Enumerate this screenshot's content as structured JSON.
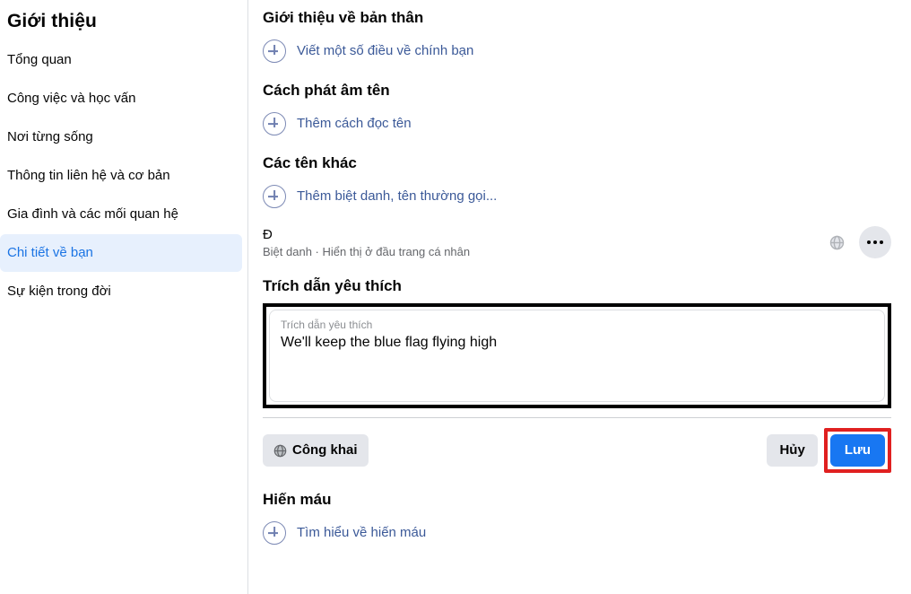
{
  "sidebar": {
    "title": "Giới thiệu",
    "items": [
      {
        "label": "Tổng quan",
        "active": false
      },
      {
        "label": "Công việc và học vấn",
        "active": false
      },
      {
        "label": "Nơi từng sống",
        "active": false
      },
      {
        "label": "Thông tin liên hệ và cơ bản",
        "active": false
      },
      {
        "label": "Gia đình và các mối quan hệ",
        "active": false
      },
      {
        "label": "Chi tiết về bạn",
        "active": true
      },
      {
        "label": "Sự kiện trong đời",
        "active": false
      }
    ]
  },
  "main": {
    "sections": {
      "bio": {
        "heading": "Giới thiệu về bản thân",
        "add_label": "Viết một số điều về chính bạn"
      },
      "pronunciation": {
        "heading": "Cách phát âm tên",
        "add_label": "Thêm cách đọc tên"
      },
      "other_names": {
        "heading": "Các tên khác",
        "add_label": "Thêm biệt danh, tên thường gọi...",
        "entry": {
          "name": "Đ",
          "meta": "Biệt danh · Hiển thị ở đầu trang cá nhân",
          "audience_icon": "globe-icon",
          "more_icon": "ellipsis-icon"
        }
      },
      "favorite_quote": {
        "heading": "Trích dẫn yêu thích",
        "field_label": "Trích dẫn yêu thích",
        "field_value": "We'll keep the blue flag flying high",
        "field_placeholder": "Trích dẫn yêu thích",
        "audience_button": "Công khai",
        "audience_icon": "globe-icon",
        "cancel_button": "Hủy",
        "save_button": "Lưu"
      },
      "blood_donation": {
        "heading": "Hiến máu",
        "add_label": "Tìm hiểu về hiến máu"
      }
    }
  },
  "colors": {
    "link": "#3b5998",
    "primary": "#1877f2",
    "active_nav_bg": "#e7f0fd",
    "active_nav_text": "#1b74e4",
    "highlight_black": "#000000",
    "highlight_red": "#e02020"
  }
}
